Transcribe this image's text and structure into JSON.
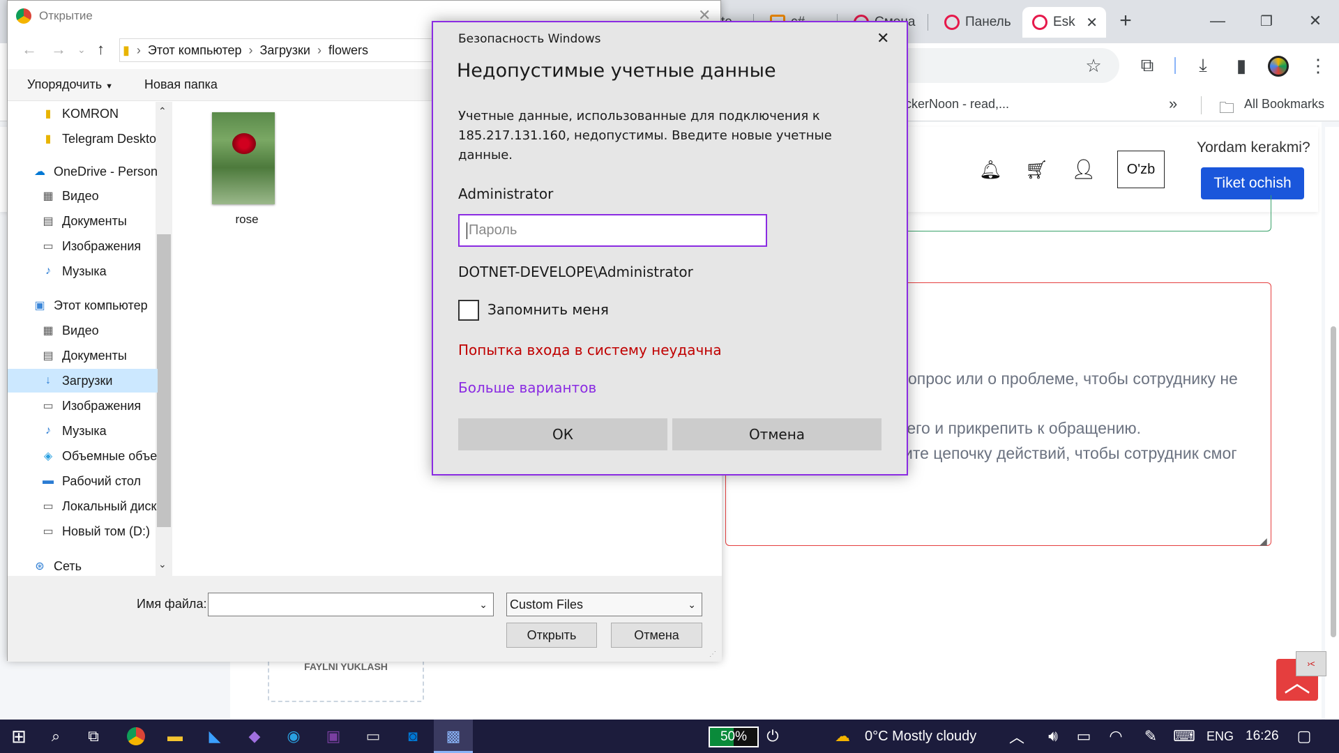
{
  "browser": {
    "tabs": [
      {
        "label": "te"
      },
      {
        "label": "c#"
      },
      {
        "label": "Смена"
      },
      {
        "label": "Панель"
      },
      {
        "label": "Esk"
      }
    ],
    "bookmarks": {
      "item": "ckerNoon - read,...",
      "all": "All Bookmarks"
    }
  },
  "site": {
    "lang": "O'zb",
    "help_text": "Yordam kerakmi?",
    "ticket_button": "Tiket ochish",
    "desc_lines": [
      "опрос или о проблеме, чтобы сотруднику не",
      "ь его и прикрепить к обращению.",
      "ите цепочку действий, чтобы сотрудник смог"
    ],
    "upload_label": "FAYLNI YUKLASH"
  },
  "file_dialog": {
    "title": "Открытие",
    "breadcrumb": [
      "Этот компьютер",
      "Загрузки",
      "flowers"
    ],
    "organize": "Упорядочить",
    "new_folder": "Новая папка",
    "sidebar": [
      {
        "label": "KOMRON",
        "icon": "folder-icon"
      },
      {
        "label": "Telegram Deskto",
        "icon": "folder-icon"
      },
      {
        "label": "OneDrive - Person",
        "icon": "cloud-icon"
      },
      {
        "label": "Видео",
        "icon": "video-icon"
      },
      {
        "label": "Документы",
        "icon": "documents-icon"
      },
      {
        "label": "Изображения",
        "icon": "images-icon"
      },
      {
        "label": "Музыка",
        "icon": "music-icon"
      },
      {
        "label": "Этот компьютер",
        "icon": "computer-icon"
      },
      {
        "label": "Видео",
        "icon": "video-icon"
      },
      {
        "label": "Документы",
        "icon": "documents-icon"
      },
      {
        "label": "Загрузки",
        "icon": "downloads-icon"
      },
      {
        "label": "Изображения",
        "icon": "images-icon"
      },
      {
        "label": "Музыка",
        "icon": "music-icon"
      },
      {
        "label": "Объемные объе",
        "icon": "3d-objects-icon"
      },
      {
        "label": "Рабочий стол",
        "icon": "desktop-icon"
      },
      {
        "label": "Локальный диск",
        "icon": "drive-icon"
      },
      {
        "label": "Новый том (D:)",
        "icon": "drive-icon"
      },
      {
        "label": "Сеть",
        "icon": "network-icon"
      }
    ],
    "selected_sidebar": "Загрузки",
    "file": {
      "name": "rose"
    },
    "filename_label": "Имя файла:",
    "filename_value": "",
    "filetype": "Custom Files",
    "open_button": "Открыть",
    "cancel_button": "Отмена"
  },
  "security_dialog": {
    "caption": "Безопасность Windows",
    "heading": "Недопустимые учетные данные",
    "message_lines": [
      "Учетные данные, использованные для подключения к",
      "185.217.131.160, недопустимы. Введите новые учетные",
      "данные."
    ],
    "username": "Administrator",
    "password_placeholder": "Пароль",
    "domain_user": "DOTNET-DEVELOPE\\Administrator",
    "remember_label": "Запомнить меня",
    "error": "Попытка входа в систему неудачна",
    "more_options": "Больше вариантов",
    "ok_button": "ОК",
    "cancel_button": "Отмена",
    "accent_color": "#8a2be2",
    "error_color": "#c00000"
  },
  "taskbar": {
    "battery": "50%",
    "weather": "0°C  Mostly cloudy",
    "language": "ENG",
    "time": "16:26"
  }
}
